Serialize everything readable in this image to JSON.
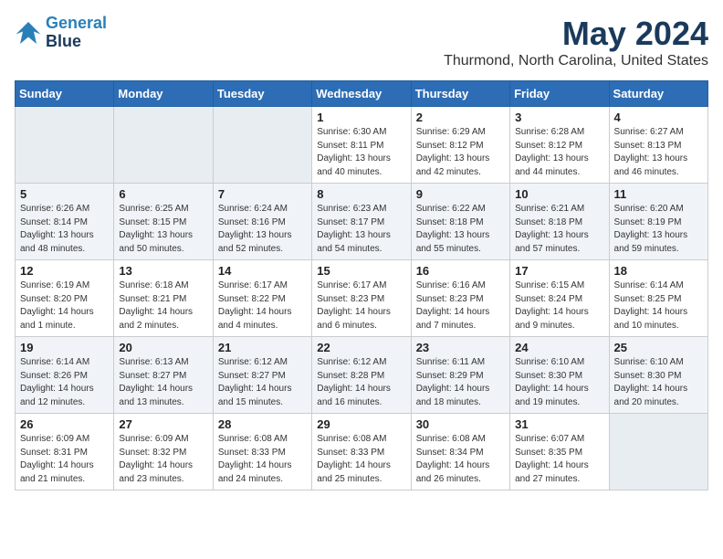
{
  "logo": {
    "line1": "General",
    "line2": "Blue"
  },
  "title": "May 2024",
  "subtitle": "Thurmond, North Carolina, United States",
  "weekdays": [
    "Sunday",
    "Monday",
    "Tuesday",
    "Wednesday",
    "Thursday",
    "Friday",
    "Saturday"
  ],
  "weeks": [
    [
      {
        "day": "",
        "info": ""
      },
      {
        "day": "",
        "info": ""
      },
      {
        "day": "",
        "info": ""
      },
      {
        "day": "1",
        "info": "Sunrise: 6:30 AM\nSunset: 8:11 PM\nDaylight: 13 hours\nand 40 minutes."
      },
      {
        "day": "2",
        "info": "Sunrise: 6:29 AM\nSunset: 8:12 PM\nDaylight: 13 hours\nand 42 minutes."
      },
      {
        "day": "3",
        "info": "Sunrise: 6:28 AM\nSunset: 8:12 PM\nDaylight: 13 hours\nand 44 minutes."
      },
      {
        "day": "4",
        "info": "Sunrise: 6:27 AM\nSunset: 8:13 PM\nDaylight: 13 hours\nand 46 minutes."
      }
    ],
    [
      {
        "day": "5",
        "info": "Sunrise: 6:26 AM\nSunset: 8:14 PM\nDaylight: 13 hours\nand 48 minutes."
      },
      {
        "day": "6",
        "info": "Sunrise: 6:25 AM\nSunset: 8:15 PM\nDaylight: 13 hours\nand 50 minutes."
      },
      {
        "day": "7",
        "info": "Sunrise: 6:24 AM\nSunset: 8:16 PM\nDaylight: 13 hours\nand 52 minutes."
      },
      {
        "day": "8",
        "info": "Sunrise: 6:23 AM\nSunset: 8:17 PM\nDaylight: 13 hours\nand 54 minutes."
      },
      {
        "day": "9",
        "info": "Sunrise: 6:22 AM\nSunset: 8:18 PM\nDaylight: 13 hours\nand 55 minutes."
      },
      {
        "day": "10",
        "info": "Sunrise: 6:21 AM\nSunset: 8:18 PM\nDaylight: 13 hours\nand 57 minutes."
      },
      {
        "day": "11",
        "info": "Sunrise: 6:20 AM\nSunset: 8:19 PM\nDaylight: 13 hours\nand 59 minutes."
      }
    ],
    [
      {
        "day": "12",
        "info": "Sunrise: 6:19 AM\nSunset: 8:20 PM\nDaylight: 14 hours\nand 1 minute."
      },
      {
        "day": "13",
        "info": "Sunrise: 6:18 AM\nSunset: 8:21 PM\nDaylight: 14 hours\nand 2 minutes."
      },
      {
        "day": "14",
        "info": "Sunrise: 6:17 AM\nSunset: 8:22 PM\nDaylight: 14 hours\nand 4 minutes."
      },
      {
        "day": "15",
        "info": "Sunrise: 6:17 AM\nSunset: 8:23 PM\nDaylight: 14 hours\nand 6 minutes."
      },
      {
        "day": "16",
        "info": "Sunrise: 6:16 AM\nSunset: 8:23 PM\nDaylight: 14 hours\nand 7 minutes."
      },
      {
        "day": "17",
        "info": "Sunrise: 6:15 AM\nSunset: 8:24 PM\nDaylight: 14 hours\nand 9 minutes."
      },
      {
        "day": "18",
        "info": "Sunrise: 6:14 AM\nSunset: 8:25 PM\nDaylight: 14 hours\nand 10 minutes."
      }
    ],
    [
      {
        "day": "19",
        "info": "Sunrise: 6:14 AM\nSunset: 8:26 PM\nDaylight: 14 hours\nand 12 minutes."
      },
      {
        "day": "20",
        "info": "Sunrise: 6:13 AM\nSunset: 8:27 PM\nDaylight: 14 hours\nand 13 minutes."
      },
      {
        "day": "21",
        "info": "Sunrise: 6:12 AM\nSunset: 8:27 PM\nDaylight: 14 hours\nand 15 minutes."
      },
      {
        "day": "22",
        "info": "Sunrise: 6:12 AM\nSunset: 8:28 PM\nDaylight: 14 hours\nand 16 minutes."
      },
      {
        "day": "23",
        "info": "Sunrise: 6:11 AM\nSunset: 8:29 PM\nDaylight: 14 hours\nand 18 minutes."
      },
      {
        "day": "24",
        "info": "Sunrise: 6:10 AM\nSunset: 8:30 PM\nDaylight: 14 hours\nand 19 minutes."
      },
      {
        "day": "25",
        "info": "Sunrise: 6:10 AM\nSunset: 8:30 PM\nDaylight: 14 hours\nand 20 minutes."
      }
    ],
    [
      {
        "day": "26",
        "info": "Sunrise: 6:09 AM\nSunset: 8:31 PM\nDaylight: 14 hours\nand 21 minutes."
      },
      {
        "day": "27",
        "info": "Sunrise: 6:09 AM\nSunset: 8:32 PM\nDaylight: 14 hours\nand 23 minutes."
      },
      {
        "day": "28",
        "info": "Sunrise: 6:08 AM\nSunset: 8:33 PM\nDaylight: 14 hours\nand 24 minutes."
      },
      {
        "day": "29",
        "info": "Sunrise: 6:08 AM\nSunset: 8:33 PM\nDaylight: 14 hours\nand 25 minutes."
      },
      {
        "day": "30",
        "info": "Sunrise: 6:08 AM\nSunset: 8:34 PM\nDaylight: 14 hours\nand 26 minutes."
      },
      {
        "day": "31",
        "info": "Sunrise: 6:07 AM\nSunset: 8:35 PM\nDaylight: 14 hours\nand 27 minutes."
      },
      {
        "day": "",
        "info": ""
      }
    ]
  ]
}
